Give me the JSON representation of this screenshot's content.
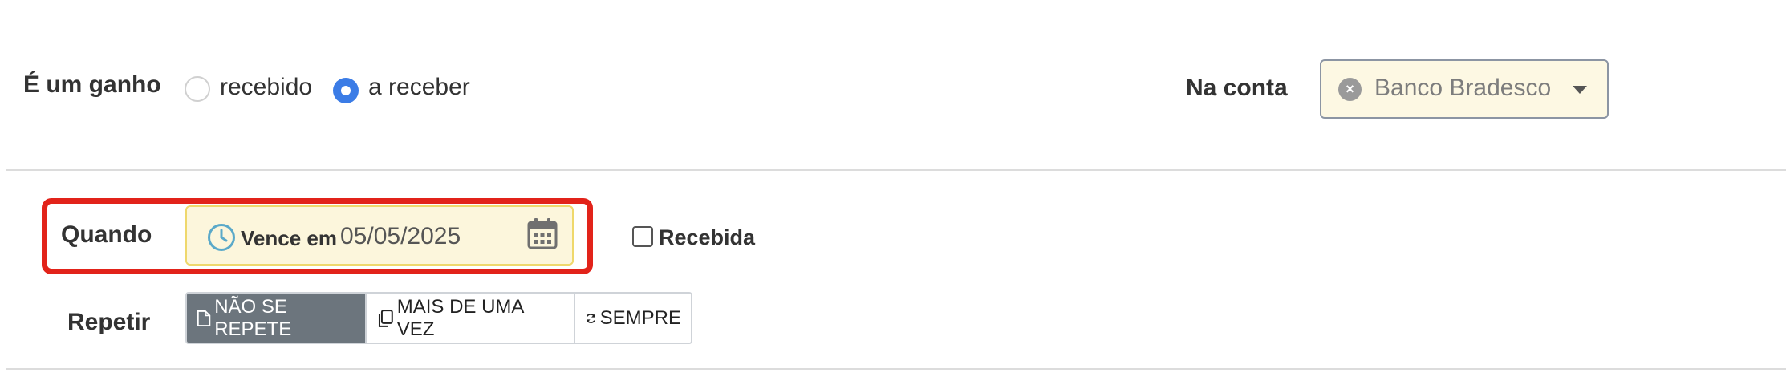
{
  "gain": {
    "label": "É um ganho",
    "options": [
      {
        "label": "recebido",
        "checked": false
      },
      {
        "label": "a receber",
        "checked": true
      }
    ]
  },
  "account": {
    "label": "Na conta",
    "selected": "Banco Bradesco",
    "clear_icon": "x-circle-icon",
    "dropdown_icon": "caret-down-icon"
  },
  "when": {
    "label": "Quando",
    "date_prefix": "Vence em",
    "date_value": "05/05/2025",
    "prefix_icon": "clock-icon",
    "calendar_icon": "calendar-icon",
    "received_label": "Recebida",
    "received_checked": false
  },
  "repeat": {
    "label": "Repetir",
    "options": [
      {
        "label": "NÃO SE REPETE",
        "icon": "file-icon",
        "active": true
      },
      {
        "label": "MAIS DE UMA VEZ",
        "icon": "copy-icon",
        "active": false
      },
      {
        "label": "SEMPRE",
        "icon": "refresh-icon",
        "active": false
      }
    ]
  },
  "colors": {
    "accent_blue": "#3b7ce6",
    "highlight_red": "#e2231a",
    "date_bg": "#fcf6dc",
    "select_bg": "#fdf8e3",
    "active_segment": "#6c757d"
  }
}
